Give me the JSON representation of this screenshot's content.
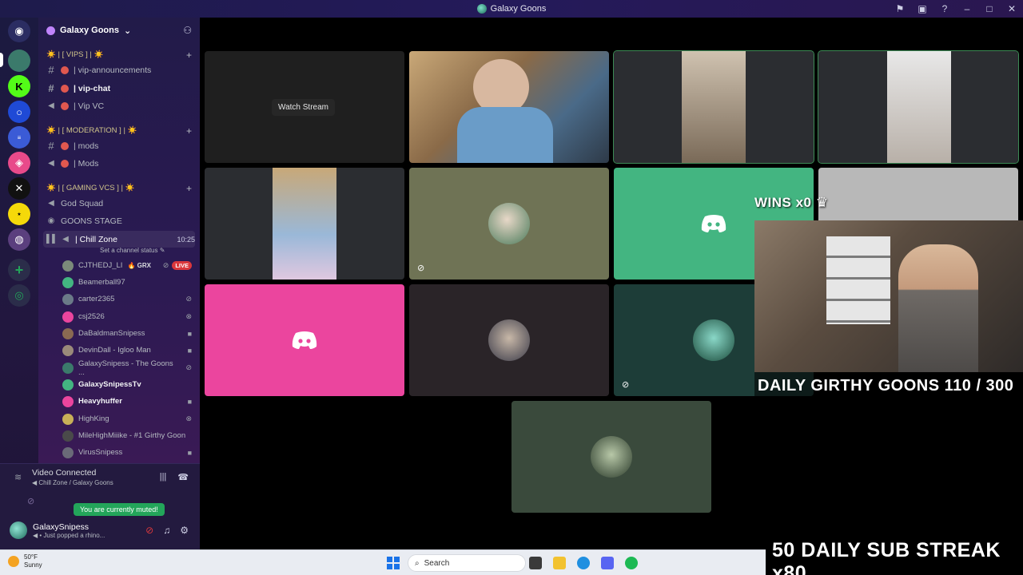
{
  "window": {
    "title": "Galaxy Goons"
  },
  "guild": {
    "name": "Galaxy Goons"
  },
  "channels": {
    "cat_vips": "☀️ | [ VIPS ] | ☀️",
    "vip_announcements": "| vip-announcements",
    "vip_chat": "| vip-chat",
    "vip_vc": "| Vip VC",
    "cat_moderation": "☀️ | [ MODERATION ] | ☀️",
    "mods_text": "| mods",
    "mods_voice": "| Mods",
    "cat_gaming": "☀️ | [ GAMING VCS ] | ☀️",
    "god_squad": "God Squad",
    "goons_stage": "GOONS STAGE",
    "chill_zone": "| Chill Zone",
    "chill_zone_timer": "10:25",
    "set_status": "Set a channel status"
  },
  "members": [
    {
      "name": "CJTHEDJ_LI",
      "tag": "GRX",
      "badge": "LIVE"
    },
    {
      "name": "Beamerball97"
    },
    {
      "name": "carter2365"
    },
    {
      "name": "csj2526"
    },
    {
      "name": "DaBaldmanSnipess"
    },
    {
      "name": "DevinDall - Igloo Man"
    },
    {
      "name": "GalaxySnipess - The Goons ..."
    },
    {
      "name": "GalaxySnipessTv"
    },
    {
      "name": "Heavyhuffer"
    },
    {
      "name": "HighKing"
    },
    {
      "name": "MileHighMiiike - #1 Girthy Goon"
    },
    {
      "name": "VirusSnipess"
    }
  ],
  "voice": {
    "status": "Video Connected",
    "location": "Chill Zone / Galaxy Goons",
    "muted_toast": "You are currently muted!"
  },
  "user": {
    "name": "GalaxySnipess",
    "status": "Just popped a rhino..."
  },
  "stage": {
    "watch_stream": "Watch Stream"
  },
  "overlay": {
    "wins": "WINS x0",
    "daily_goons": "DAILY GIRTHY GOONS  110 / 300",
    "sub_streak": "50 DAILY SUB STREAK x80"
  },
  "taskbar": {
    "weather_temp": "50°F",
    "weather_desc": "Sunny",
    "search_placeholder": "Search"
  },
  "colors": {
    "discord_green": "#43b581",
    "discord_pink": "#eb459e",
    "live_red": "#da373c"
  }
}
